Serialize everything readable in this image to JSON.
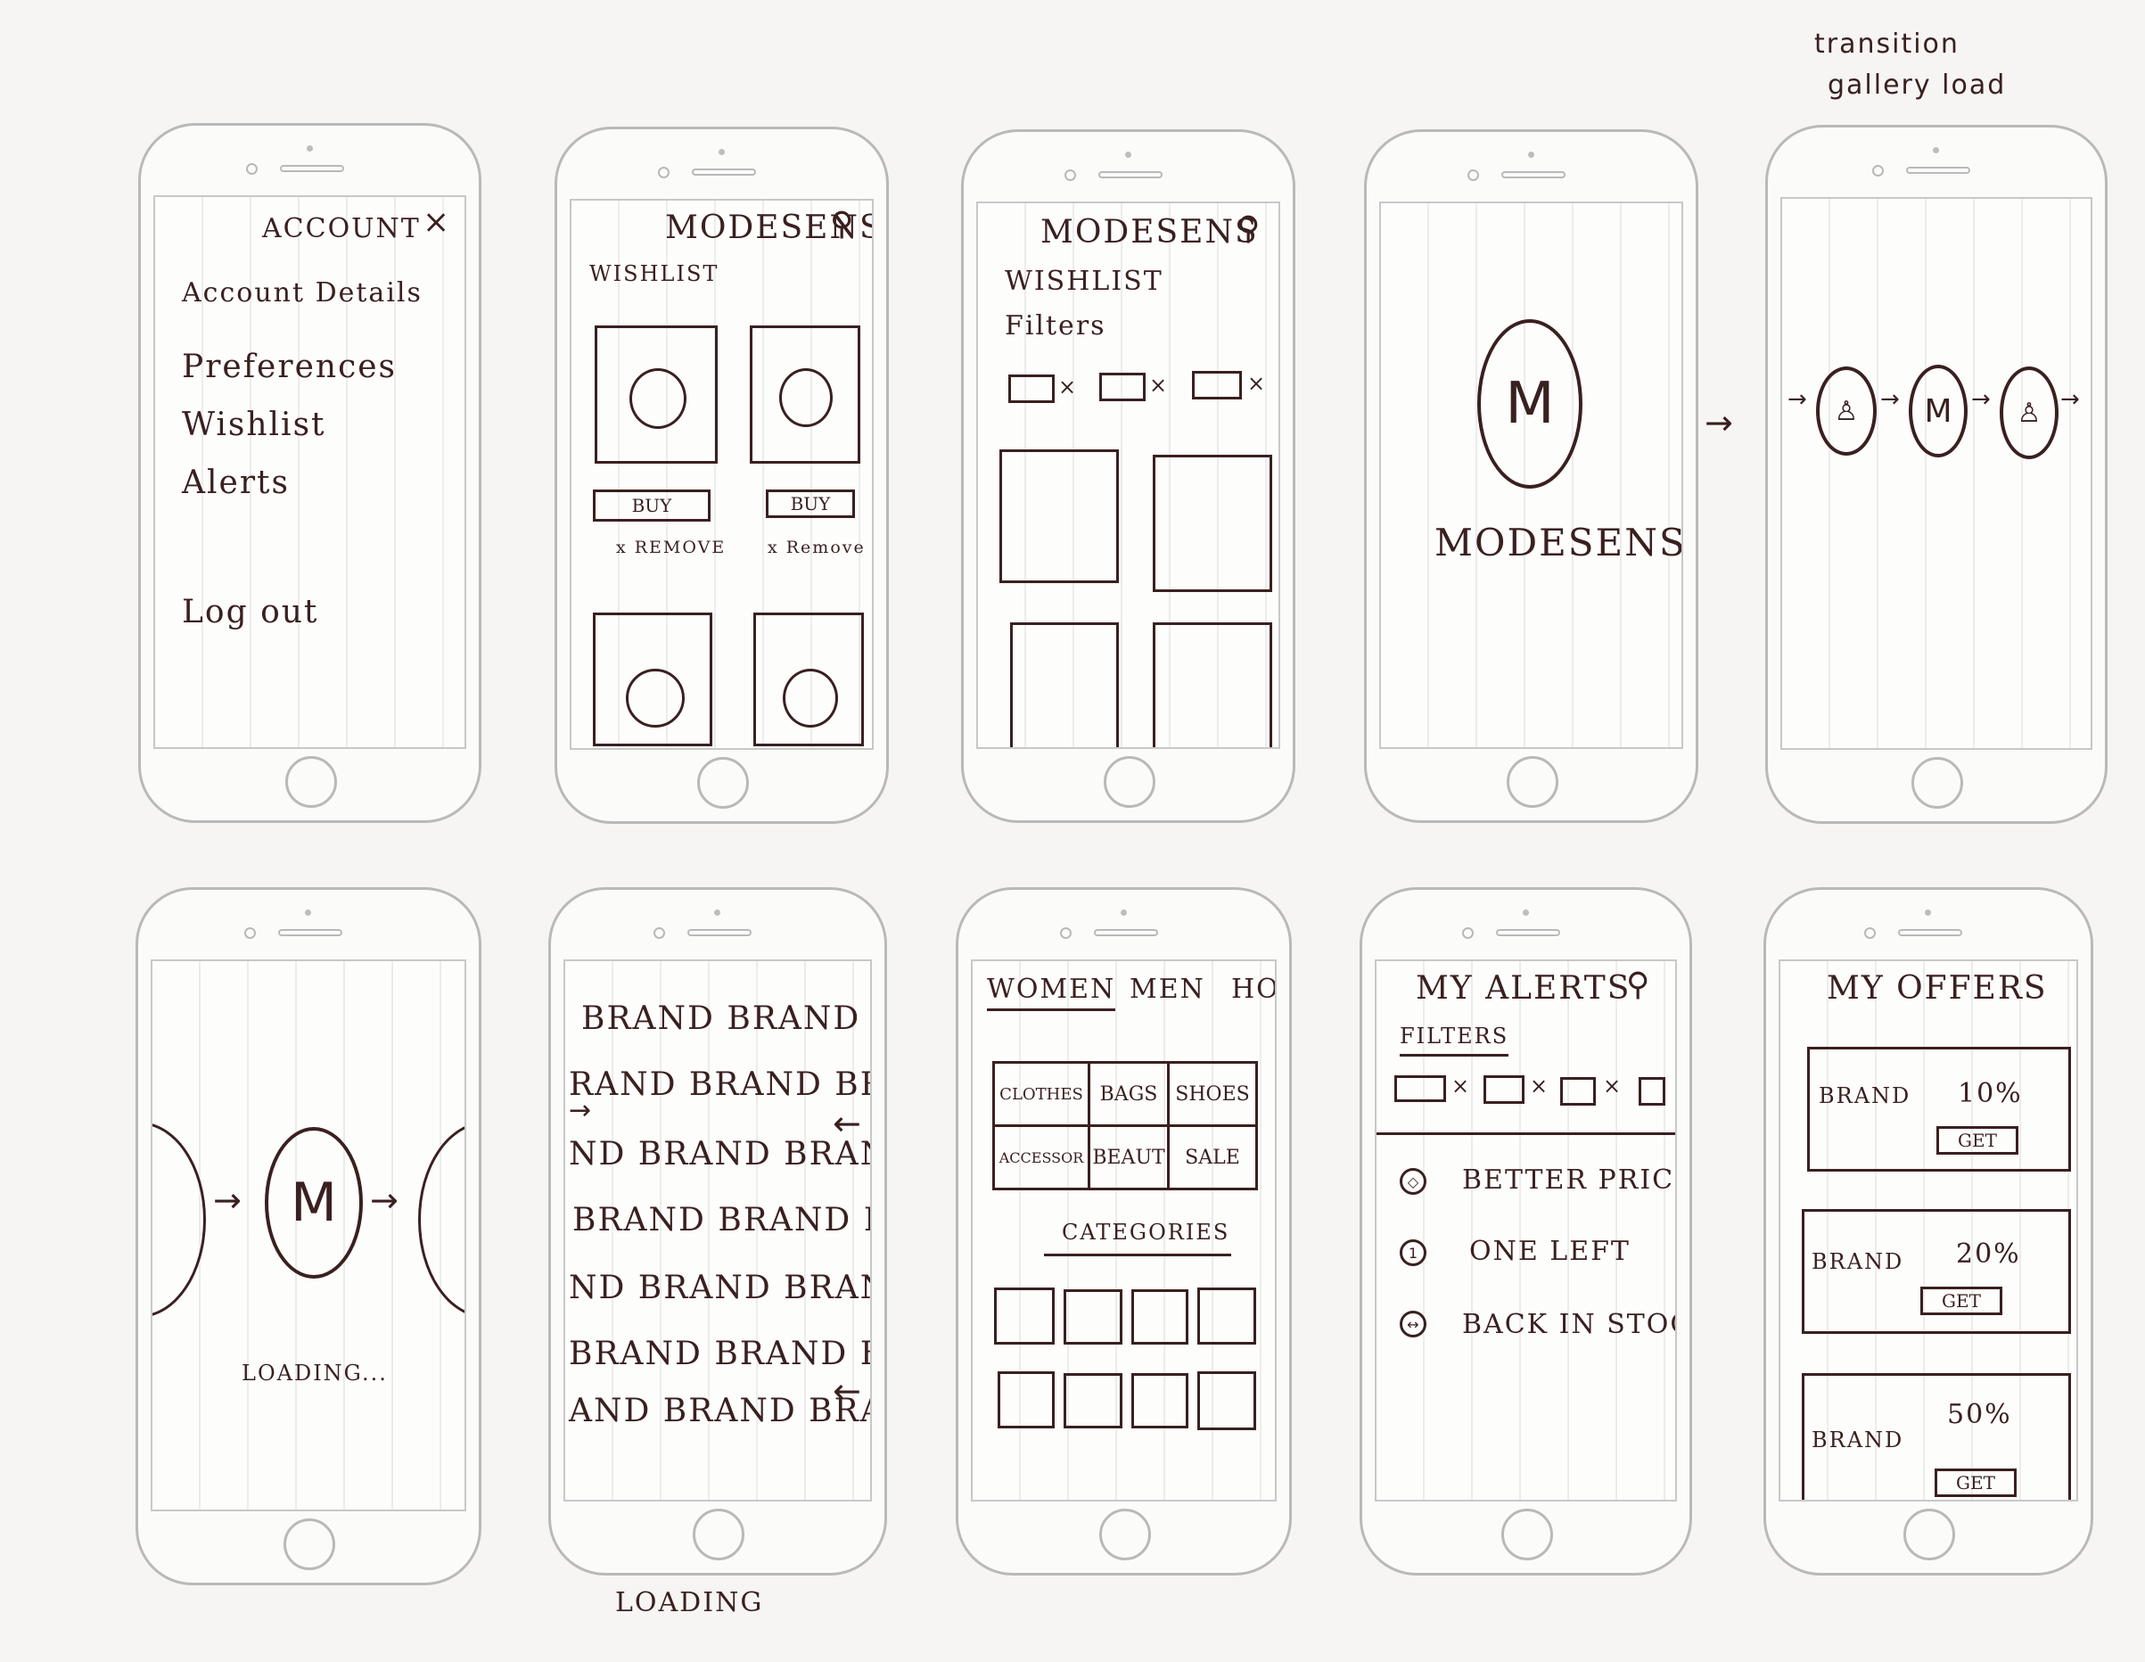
{
  "annotations": {
    "top_right_line1": "transition",
    "top_right_line2": "gallery load",
    "bottom_loading": "LOADING"
  },
  "screens": {
    "account": {
      "title": "ACCOUNT",
      "close": "×",
      "items": [
        "Account Details",
        "Preferences",
        "Wishlist",
        "Alerts"
      ],
      "logout": "Log out"
    },
    "wishlist1": {
      "title": "MODESENS",
      "subtitle": "WISHLIST",
      "buy": "BUY",
      "remove_left": "x REMOVE",
      "remove_right": "x Remove"
    },
    "wishlist2": {
      "title": "MODESENS",
      "subtitle": "WISHLIST",
      "filters": "Filters"
    },
    "splash": {
      "logo": "M",
      "name": "MODESENS"
    },
    "transition": {
      "logo": "M"
    },
    "loading": {
      "logo": "M",
      "label": "LOADING..."
    },
    "brands": {
      "rows": [
        "BRAND BRAND B",
        "RAND BRAND BRA",
        "ND BRAND BRAND",
        "BRAND BRAND BR",
        "ND BRAND BRAN",
        "BRAND BRAND BR",
        "AND BRAND BRAN"
      ]
    },
    "categories": {
      "tabs": [
        "WOMEN",
        "MEN",
        "HOM"
      ],
      "grid": [
        "CLOTHES",
        "BAGS",
        "SHOES",
        "ACCESSOR",
        "BEAUT",
        "SALE"
      ],
      "label": "CATEGORIES"
    },
    "alerts": {
      "title": "MY ALERTS",
      "filters": "FILTERS",
      "items": [
        {
          "icon": "price-tag-icon",
          "text": "BETTER PRICE"
        },
        {
          "icon": "one-icon",
          "text": "ONE LEFT"
        },
        {
          "icon": "restock-icon",
          "text": "BACK IN STOCK"
        }
      ]
    },
    "offers": {
      "title": "MY OFFERS",
      "items": [
        {
          "brand": "BRAND",
          "discount": "10%",
          "cta": "GET"
        },
        {
          "brand": "BRAND",
          "discount": "20%",
          "cta": "GET"
        },
        {
          "brand": "BRAND",
          "discount": "50%",
          "cta": "GET"
        }
      ]
    }
  }
}
